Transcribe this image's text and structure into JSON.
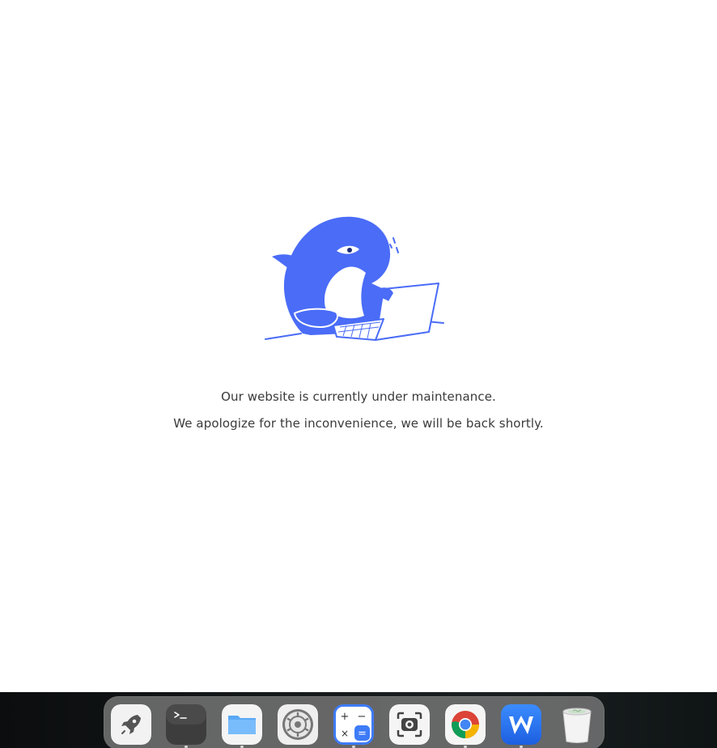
{
  "maintenance": {
    "line1": "Our website is currently under maintenance.",
    "line2": "We apologize for the inconvenience, we will be back shortly."
  },
  "colors": {
    "accent": "#4a6cf7",
    "text": "#3a3a3a",
    "background": "#ffffff",
    "taskbar": "#15191b",
    "dock": "#7a7a7a"
  },
  "dock": {
    "items": [
      {
        "name": "launcher",
        "icon": "rocket-icon"
      },
      {
        "name": "terminal",
        "icon": "terminal-icon"
      },
      {
        "name": "files",
        "icon": "folder-icon"
      },
      {
        "name": "settings",
        "icon": "gear-icon"
      },
      {
        "name": "calculator",
        "icon": "calculator-icon"
      },
      {
        "name": "screenshot",
        "icon": "camera-icon"
      },
      {
        "name": "chrome",
        "icon": "chrome-icon"
      },
      {
        "name": "wps",
        "icon": "wps-office-icon"
      },
      {
        "name": "trash",
        "icon": "trash-icon"
      }
    ]
  }
}
